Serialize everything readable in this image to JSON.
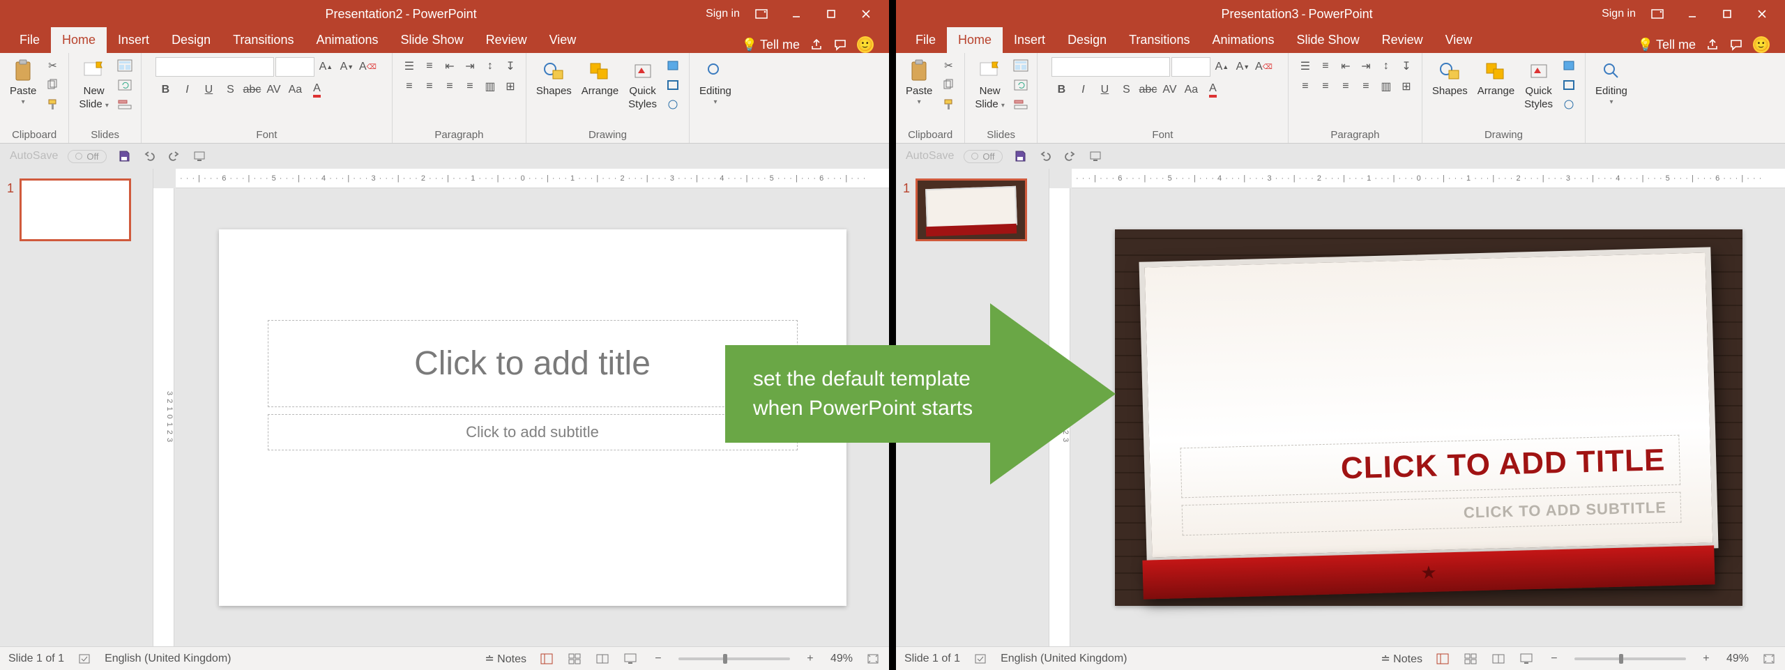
{
  "left": {
    "title_doc": "Presentation2",
    "title_app": "PowerPoint",
    "signin": "Sign in",
    "tabs": [
      "File",
      "Home",
      "Insert",
      "Design",
      "Transitions",
      "Animations",
      "Slide Show",
      "Review",
      "View"
    ],
    "tellme": "Tell me",
    "groups": {
      "clipboard_label": "Clipboard",
      "paste": "Paste",
      "slides_label": "Slides",
      "new_slide_l1": "New",
      "new_slide_l2": "Slide",
      "font_label": "Font",
      "paragraph_label": "Paragraph",
      "drawing_label": "Drawing",
      "shapes": "Shapes",
      "arrange": "Arrange",
      "quick_l1": "Quick",
      "quick_l2": "Styles",
      "editing": "Editing"
    },
    "qat": {
      "autosave": "AutoSave",
      "off": "Off"
    },
    "ruler_h": "· · · | · · · 6 · · · | · · · 5 · · · | · · · 4 · · · | · · · 3 · · · | · · · 2 · · · | · · · 1 · · · | · · · 0 · · · | · · · 1 · · · | · · · 2 · · · | · · · 3 · · · | · · · 4 · · · | · · · 5 · · · | · · · 6 · · · | · · ·",
    "ruler_v": "3  2  1  0  1  2  3",
    "slide_num": "1",
    "slide_title_ph": "Click to add title",
    "slide_sub_ph": "Click to add subtitle",
    "status": {
      "slide_of": "Slide 1 of 1",
      "lang": "English (United Kingdom)",
      "notes": "Notes",
      "zoom": "49%"
    }
  },
  "right": {
    "title_doc": "Presentation3",
    "title_app": "PowerPoint",
    "signin": "Sign in",
    "tabs": [
      "File",
      "Home",
      "Insert",
      "Design",
      "Transitions",
      "Animations",
      "Slide Show",
      "Review",
      "View"
    ],
    "tellme": "Tell me",
    "groups": {
      "clipboard_label": "Clipboard",
      "paste": "Paste",
      "slides_label": "Slides",
      "new_slide_l1": "New",
      "new_slide_l2": "Slide",
      "font_label": "Font",
      "paragraph_label": "Paragraph",
      "drawing_label": "Drawing",
      "shapes": "Shapes",
      "arrange": "Arrange",
      "quick_l1": "Quick",
      "quick_l2": "Styles",
      "editing": "Editing"
    },
    "qat": {
      "autosave": "AutoSave",
      "off": "Off"
    },
    "ruler_h": "· · · | · · · 6 · · · | · · · 5 · · · | · · · 4 · · · | · · · 3 · · · | · · · 2 · · · | · · · 1 · · · | · · · 0 · · · | · · · 1 · · · | · · · 2 · · · | · · · 3 · · · | · · · 4 · · · | · · · 5 · · · | · · · 6 · · · | · · ·",
    "ruler_v": "3  2  1  0  1  2  3",
    "slide_num": "1",
    "slide_title_ph": "CLICK TO ADD TITLE",
    "slide_sub_ph": "CLICK TO ADD SUBTITLE",
    "status": {
      "slide_of": "Slide 1 of 1",
      "lang": "English (United Kingdom)",
      "notes": "Notes",
      "zoom": "49%"
    }
  },
  "callout_l1": "set the default template",
  "callout_l2": "when PowerPoint starts"
}
